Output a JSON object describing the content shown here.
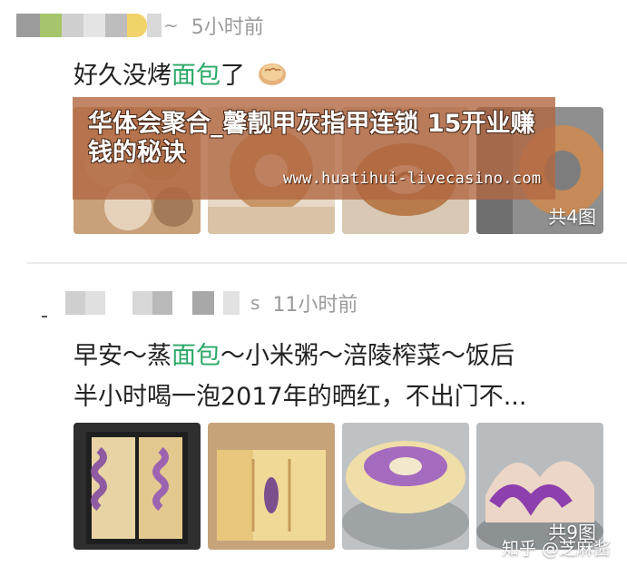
{
  "posts": [
    {
      "time": "5小时前",
      "text_before": "好久没烤",
      "highlight": "面包",
      "text_after": "了",
      "emoji_icon": "bread-emoji",
      "image_count": "共4图"
    },
    {
      "time": "11小时前",
      "line1_before": "早安～蒸",
      "highlight": "面包",
      "line1_after": "～小米粥～涪陵榨菜～饭后",
      "line2": "半小时喝一泡2017年的晒红，不出门不...",
      "image_count": "共9图"
    }
  ],
  "ad": {
    "title": "华体会聚合_馨靓甲灰指甲连锁 15开业赚钱的秘诀",
    "url": "www.huatihui-livecasino.com"
  },
  "watermark": "知乎 @芝麻酱",
  "colors": {
    "highlight": "#2aa866",
    "time": "#9a9a9a",
    "ad_bg": "#b26842"
  }
}
